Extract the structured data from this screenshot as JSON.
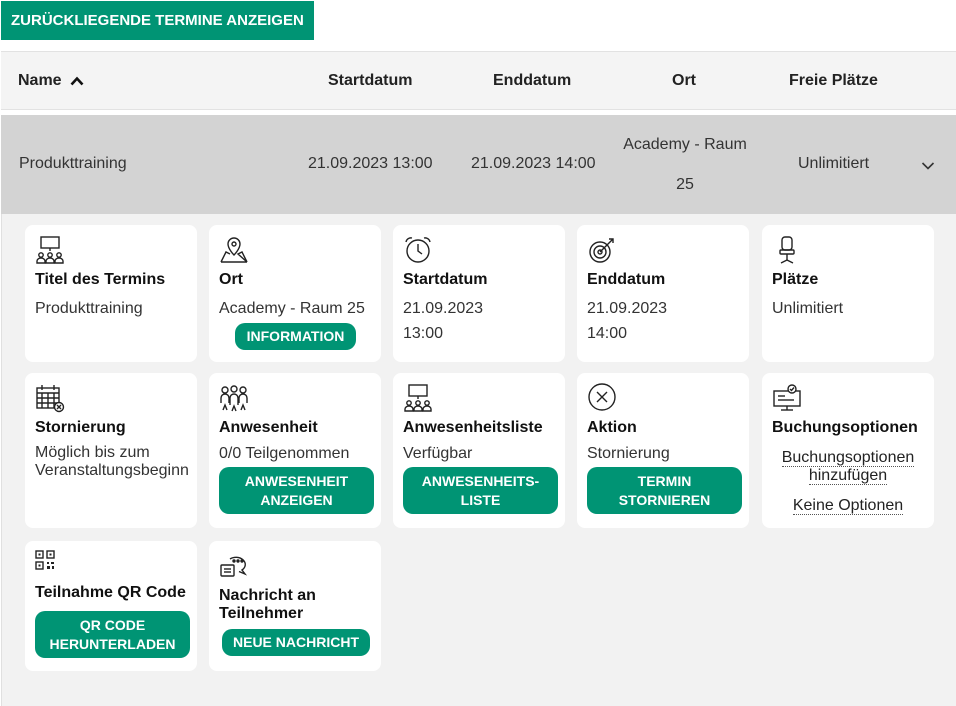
{
  "top_button": {
    "label": "ZURÜCKLIEGENDE TERMINE ANZEIGEN"
  },
  "table": {
    "columns": {
      "name": "Name",
      "start": "Startdatum",
      "end": "Enddatum",
      "ort": "Ort",
      "frei": "Freie Plätze"
    },
    "row": {
      "name": "Produkttraining",
      "start": "21.09.2023 13:00",
      "end": "21.09.2023 14:00",
      "ort_line1": "Academy - Raum",
      "ort_line2": "25",
      "frei": "Unlimitiert"
    }
  },
  "cards": {
    "titel": {
      "icon": "presentation-icon",
      "title": "Titel des Termins",
      "text": "Produkttraining"
    },
    "ort": {
      "icon": "map-pin-icon",
      "title": "Ort",
      "text": "Academy - Raum 25",
      "button": "INFORMATION"
    },
    "start": {
      "icon": "alarm-clock-icon",
      "title": "Startdatum",
      "date": "21.09.2023",
      "time": "13:00"
    },
    "ende": {
      "icon": "target-icon",
      "title": "Enddatum",
      "date": "21.09.2023",
      "time": "14:00"
    },
    "plaetze": {
      "icon": "chair-icon",
      "title": "Plätze",
      "text": "Unlimitiert"
    },
    "stornierung": {
      "icon": "calendar-cancel-icon",
      "title": "Stornierung",
      "text": "Möglich bis zum Veranstaltungsbeginn"
    },
    "anwesenheit": {
      "icon": "group-icon",
      "title": "Anwesenheit",
      "text": "0/0 Teilgenommen",
      "button_line1": "ANWESENHEIT",
      "button_line2": "ANZEIGEN"
    },
    "liste": {
      "icon": "presentation-icon",
      "title": "Anwesenheitsliste",
      "text": "Verfügbar",
      "button_line1": "ANWESENHEITS-",
      "button_line2": "LISTE"
    },
    "aktion": {
      "icon": "close-circle-icon",
      "title": "Aktion",
      "text": "Stornierung",
      "button_line1": "TERMIN",
      "button_line2": "STORNIEREN"
    },
    "buchung": {
      "icon": "monitor-settings-icon",
      "title": "Buchungsoptionen",
      "link1_line1": "Buchungsoptionen",
      "link1_line2": "hinzufügen",
      "link2": "Keine Optionen"
    },
    "qr": {
      "icon": "qr-code-icon",
      "title": "Teilnahme QR Code",
      "button_line1": "QR CODE",
      "button_line2": "HERUNTERLADEN"
    },
    "nachricht": {
      "icon": "chat-bubble-icon",
      "title_line1": "Nachricht an",
      "title_line2": "Teilnehmer",
      "button": "NEUE NACHRICHT"
    }
  },
  "colors": {
    "accent": "#009474",
    "row_bg": "#d3d3d3",
    "panel_bg": "#f2f2f2",
    "header_bg": "#f4f4f4"
  }
}
